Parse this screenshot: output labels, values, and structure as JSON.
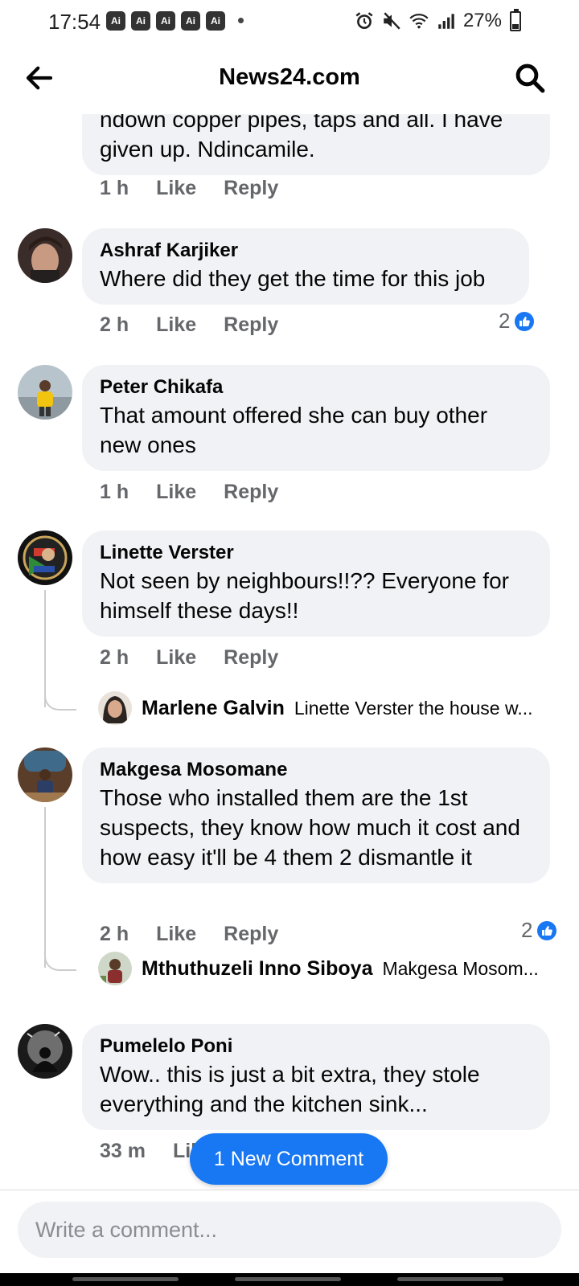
{
  "status_bar": {
    "time": "17:54",
    "ai_badges": [
      "Ai",
      "Ai",
      "Ai",
      "Ai",
      "Ai"
    ],
    "battery": "27%",
    "icons": [
      "alarm-icon",
      "mute-icon",
      "wifi-icon",
      "signal-icon",
      "battery-icon"
    ]
  },
  "header": {
    "title": "News24.com",
    "back_icon": "back-arrow-icon",
    "search_icon": "search-icon"
  },
  "comments": [
    {
      "text_partial": "ndown copper pipes, taps and all. I have given up. Ndincamile.",
      "line1": "ndown copper pipes, taps and all. I have",
      "line2": "given up. Ndincamile.",
      "time": "1 h"
    },
    {
      "name": "Ashraf Karjiker",
      "text": "Where did they get the time for this job",
      "time": "2 h",
      "reactions": "2"
    },
    {
      "name": "Peter Chikafa",
      "text": "That amount offered she can buy other new ones",
      "time": "1 h"
    },
    {
      "name": "Linette Verster",
      "text": "Not seen by neighbours!!?? Everyone for himself these days!!",
      "time": "2 h",
      "reply": {
        "name": "Marlene Galvin",
        "text": "Linette Verster the house w..."
      }
    },
    {
      "name": "Makgesa Mosomane",
      "text": "Those who installed them are the 1st suspects, they know how much it cost and how easy it'll be 4 them 2 dismantle it",
      "time": "2 h",
      "reactions": "2",
      "reply": {
        "name": "Mthuthuzeli Inno Siboya",
        "text": "Makgesa Mosom..."
      }
    },
    {
      "name": "Pumelelo Poni",
      "text": "Wow.. this is just a bit extra, they stole everything and the kitchen sink...",
      "time": "33 m"
    }
  ],
  "actions": {
    "like": "Like",
    "reply": "Reply"
  },
  "new_comment_pill": "1 New Comment",
  "composer": {
    "placeholder": "Write a comment..."
  },
  "colors": {
    "accent": "#1877f2",
    "bubble": "#f0f2f5",
    "meta": "#65676b"
  }
}
